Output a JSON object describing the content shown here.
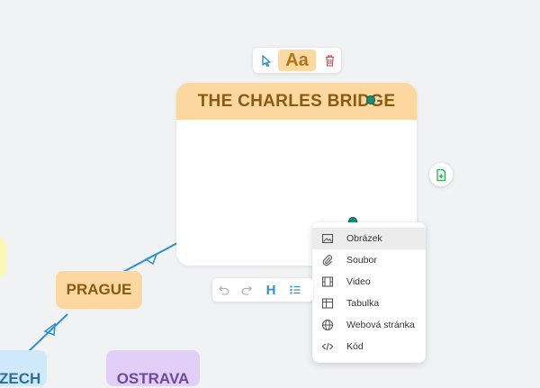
{
  "colors": {
    "background": "#f1f2f4",
    "card_header": "#fcd7a0",
    "accent_blue": "#2f8fd0",
    "delete_red": "#e05555",
    "file_green": "#3aa55d"
  },
  "top_toolbar": {
    "select_icon": "cursor-arrow-icon",
    "text_style_label": "Aa",
    "delete_icon": "trash-icon"
  },
  "card": {
    "title": "THE CHARLES BRIDGE"
  },
  "side_button": {
    "icon": "add-file-icon"
  },
  "insert_menu": {
    "items": [
      {
        "label": "Obrázek",
        "icon": "image-icon"
      },
      {
        "label": "Soubor",
        "icon": "paperclip-icon"
      },
      {
        "label": "Video",
        "icon": "video-icon"
      },
      {
        "label": "Tabulka",
        "icon": "table-icon"
      },
      {
        "label": "Webová stránka",
        "icon": "globe-icon"
      },
      {
        "label": "Kód",
        "icon": "code-icon"
      }
    ]
  },
  "bottom_toolbar": {
    "undo_icon": "undo-icon",
    "redo_icon": "redo-icon",
    "heading_label": "H",
    "list_icon": "list-icon"
  },
  "nodes": {
    "prague": "PRAGUE",
    "ostrava": "OSTRAVA",
    "czech": "CZECH"
  }
}
